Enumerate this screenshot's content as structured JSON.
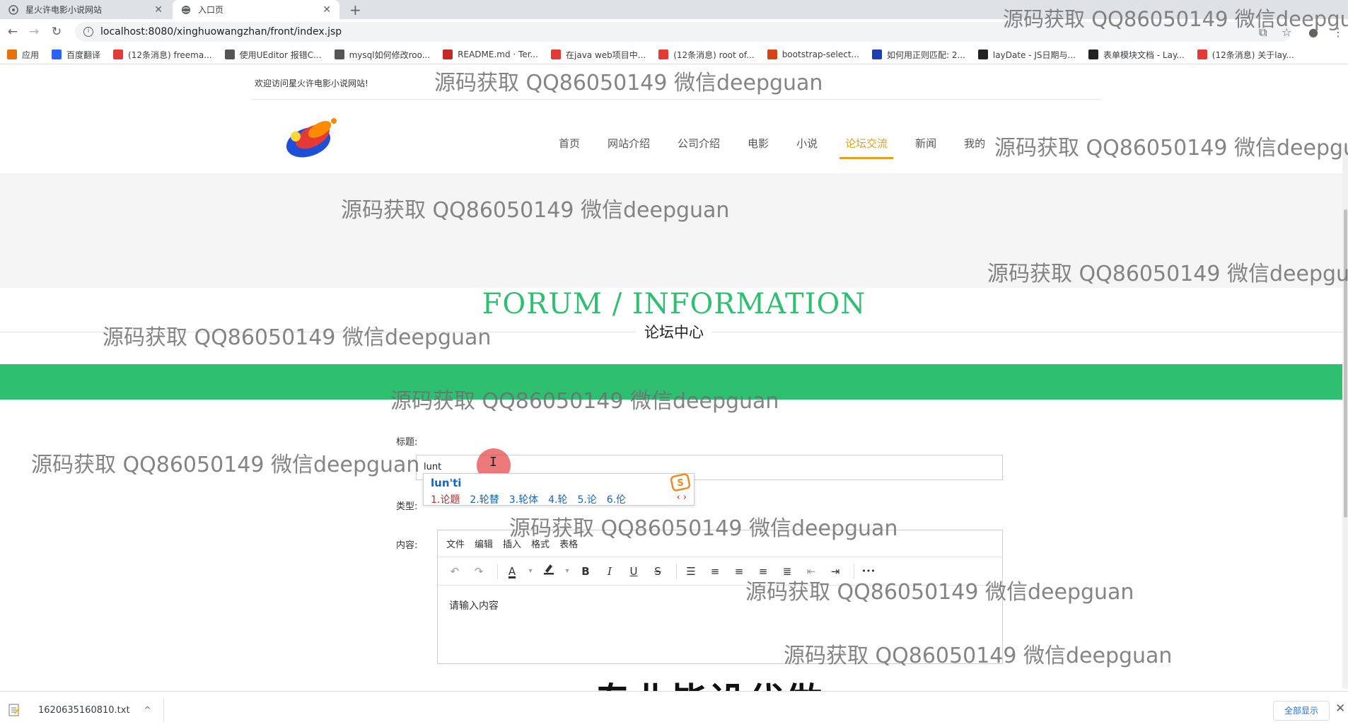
{
  "browser": {
    "tabs": [
      {
        "title": "星火许电影小说网站",
        "close": "✕"
      },
      {
        "title": "入口页",
        "close": "✕"
      }
    ],
    "new_tab": "+",
    "url": "localhost:8080/xinghuowangzhan/front/index.jsp",
    "bookmarks": [
      {
        "label": "应用",
        "color": "#e8710a"
      },
      {
        "label": "百度翻译",
        "color": "#2962ff"
      },
      {
        "label": "(12条消息) freema...",
        "color": "#e53935"
      },
      {
        "label": "使用UEditor 报错C...",
        "color": "#555555"
      },
      {
        "label": "mysql如何修改roo...",
        "color": "#555555"
      },
      {
        "label": "README.md · Ter...",
        "color": "#c62828"
      },
      {
        "label": "在java web项目中...",
        "color": "#e53935"
      },
      {
        "label": "(12条消息) root of...",
        "color": "#e53935"
      },
      {
        "label": "bootstrap-select...",
        "color": "#d84315"
      },
      {
        "label": "如何用正则匹配: 2...",
        "color": "#1e40af"
      },
      {
        "label": "layDate - JS日期与...",
        "color": "#222222"
      },
      {
        "label": "表单模块文档 - Lay...",
        "color": "#222222"
      },
      {
        "label": "(12条消息) 关于lay...",
        "color": "#e53935"
      }
    ]
  },
  "site": {
    "welcome": "欢迎访问星火许电影小说网站!",
    "nav": [
      "首页",
      "网站介绍",
      "公司介绍",
      "电影",
      "小说",
      "论坛交流",
      "新闻",
      "我的"
    ],
    "nav_active_index": 5,
    "section_title": "FORUM / INFORMATION",
    "section_subtitle": "论坛中心",
    "accent_color": "#2fbf71"
  },
  "form": {
    "title_label": "标题:",
    "title_value": "lunt",
    "type_label": "类型:",
    "content_label": "内容:",
    "ime": {
      "pinyin": "lun'ti",
      "candidates": [
        "1.论题",
        "2.轮替",
        "3.轮体",
        "4.轮",
        "5.论",
        "6.伦"
      ],
      "arrows": "‹ ›"
    },
    "editor": {
      "menus": [
        "文件",
        "编辑",
        "插入",
        "格式",
        "表格"
      ],
      "placeholder": "请输入内容",
      "tools": {
        "undo": "↶",
        "redo": "↷",
        "font_color": "A",
        "bold": "B",
        "italic": "I",
        "underline": "U",
        "strike": "S",
        "more": "•••"
      }
    }
  },
  "watermarks": {
    "text": "源码获取 QQ86050149 微信deepguan",
    "corner": "源码获取 QQ86050149 微信deepgu",
    "nav_overlay": "源码获取 QQ86050149 微信deepgu",
    "right_cut": "源码获取 QQ86050149 微信deepgua",
    "big": "专业毕设代做"
  },
  "downloads": {
    "file": "1620635160810.txt",
    "chevron": "^",
    "show_all": "全部显示",
    "close": "✕"
  }
}
